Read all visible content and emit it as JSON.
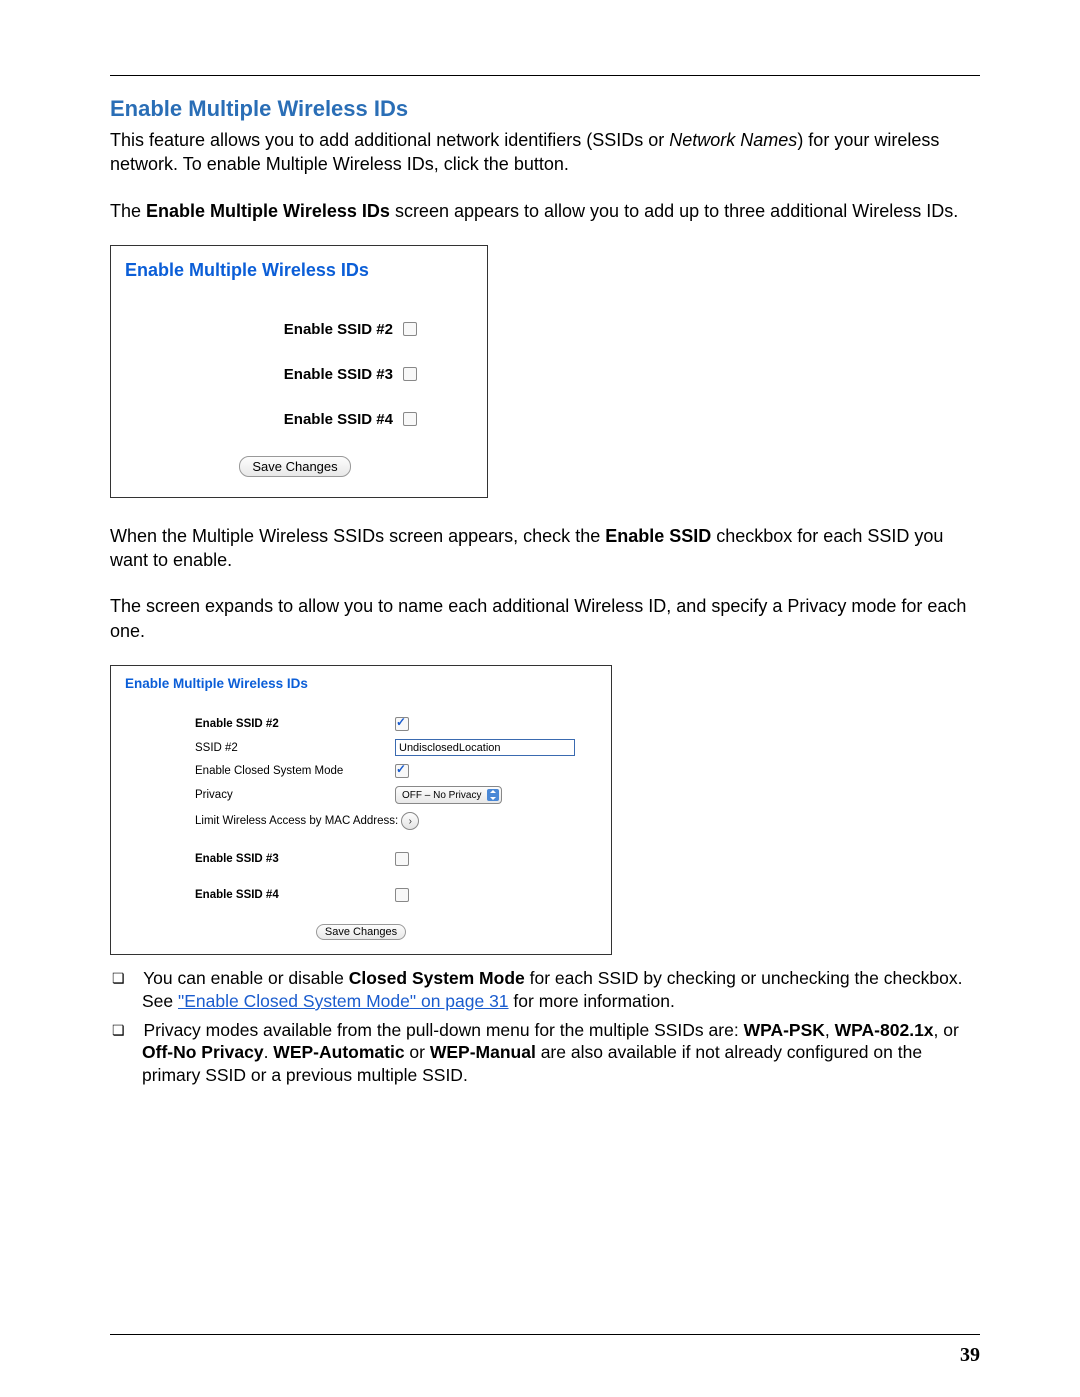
{
  "heading": "Enable Multiple Wireless IDs",
  "intro": {
    "p1a": "This feature allows you to add additional network identifiers (SSIDs or ",
    "p1b": "Network Names",
    "p1c": ") for your wireless network. To enable Multiple Wireless IDs, click the button.",
    "p2a": "The ",
    "p2b": "Enable Multiple Wireless IDs",
    "p2c": " screen appears to allow you to add up to three additional Wireless IDs."
  },
  "panel1": {
    "title": "Enable Multiple Wireless IDs",
    "rows": [
      {
        "label": "Enable SSID #2"
      },
      {
        "label": "Enable SSID #3"
      },
      {
        "label": "Enable SSID #4"
      }
    ],
    "save": "Save Changes"
  },
  "mid": {
    "p1a": "When the Multiple Wireless SSIDs screen appears, check the ",
    "p1b": "Enable SSID",
    "p1c": " checkbox for each SSID you want to enable.",
    "p2": "The screen expands to allow you to name each additional Wireless ID, and specify a Privacy mode for each one."
  },
  "panel2": {
    "title": "Enable Multiple Wireless IDs",
    "enable2": "Enable SSID #2",
    "ssid2_label": "SSID #2",
    "ssid2_value": "UndisclosedLocation",
    "closed_label": "Enable Closed System Mode",
    "privacy_label": "Privacy",
    "privacy_value": "OFF – No Privacy",
    "mac_label": "Limit Wireless Access by MAC Address:",
    "enable3": "Enable SSID #3",
    "enable4": "Enable SSID #4",
    "save": "Save Changes"
  },
  "notes": {
    "n1a": "You can enable or disable ",
    "n1b": "Closed System Mode",
    "n1c": " for each SSID by checking or unchecking the checkbox. See ",
    "n1link": "\"Enable Closed System Mode\" on page 31",
    "n1d": " for more information.",
    "n2a": "Privacy modes available from the pull-down menu for the multiple SSIDs are: ",
    "n2b": "WPA-PSK",
    "n2c": ", ",
    "n2d": "WPA-802.1x",
    "n2e": ", or ",
    "n2f": "Off-No Privacy",
    "n2g": ". ",
    "n2h": "WEP-Automatic",
    "n2i": " or ",
    "n2j": "WEP-Manual",
    "n2k": " are also available if not already configured on the primary SSID or a previous multiple SSID."
  },
  "pageNumber": "39"
}
